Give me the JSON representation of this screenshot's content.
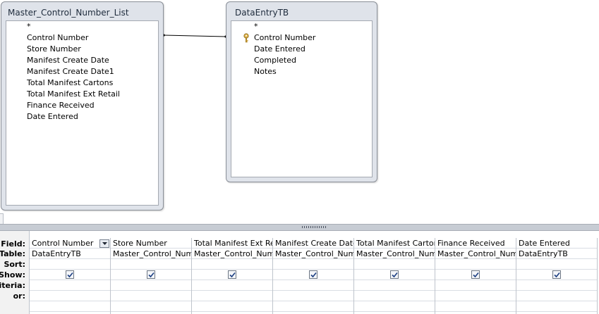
{
  "tables": [
    {
      "title": "Master_Control_Number_List",
      "fields": [
        "*",
        "Control Number",
        "Store Number",
        "Manifest Create Date",
        "Manifest Create Date1",
        "Total Manifest Cartons",
        "Total Manifest Ext Retail",
        "Finance Received",
        "Date Entered"
      ]
    },
    {
      "title": "DataEntryTB",
      "fields": [
        "*",
        "Control Number",
        "Date Entered",
        "Completed",
        "Notes"
      ],
      "primary_key": "Control Number"
    }
  ],
  "grid": {
    "row_labels": [
      "Field:",
      "Table:",
      "Sort:",
      "Show:",
      "riteria:",
      "or:"
    ],
    "columns": [
      {
        "field": "Control Number",
        "table": "DataEntryTB",
        "show": true
      },
      {
        "field": "Store Number",
        "table": "Master_Control_Numl",
        "show": true
      },
      {
        "field": "Total Manifest Ext Ret",
        "table": "Master_Control_Numl",
        "show": true
      },
      {
        "field": "Manifest Create Date:",
        "table": "Master_Control_Numl",
        "show": true
      },
      {
        "field": "Total Manifest Carton",
        "table": "Master_Control_Numl",
        "show": true
      },
      {
        "field": "Finance Received",
        "table": "Master_Control_Numl",
        "show": true
      },
      {
        "field": "Date Entered",
        "table": "DataEntryTB",
        "show": true
      }
    ]
  },
  "icons": {
    "primary_key": "key-icon",
    "dropdown": "chevron-down-icon",
    "checkbox": "checkmark-icon"
  },
  "colors": {
    "pane_bg": "#ffffff",
    "window_frame": "#dfe3ea",
    "splitter": "#c7ccd4",
    "grid_line": "#bfc4cc"
  }
}
